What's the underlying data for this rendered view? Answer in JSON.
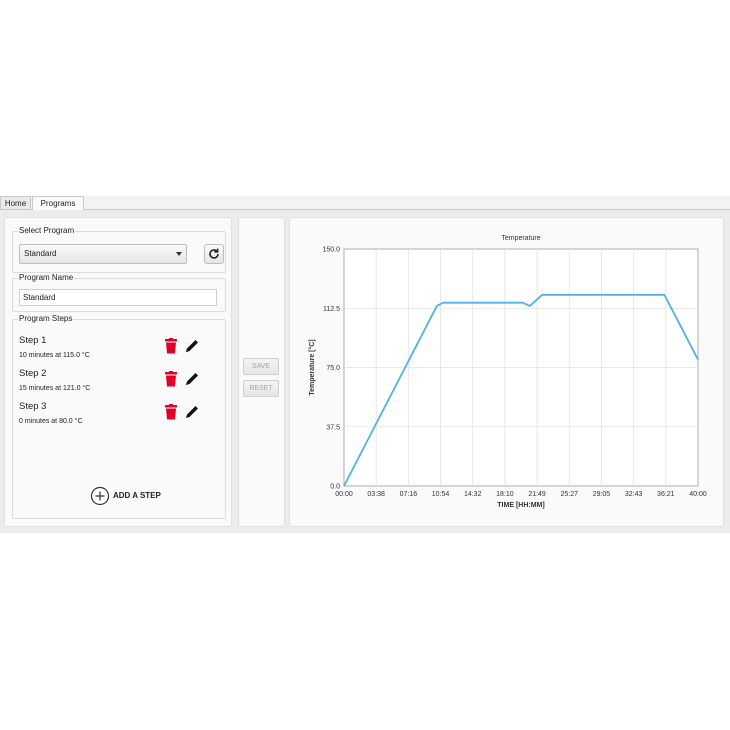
{
  "tabs": [
    {
      "label": "Home"
    },
    {
      "label": "Programs"
    }
  ],
  "select_program": {
    "label": "Select Program",
    "value": "Standard"
  },
  "program_name": {
    "label": "Program Name",
    "value": "Standard"
  },
  "program_steps": {
    "label": "Program Steps",
    "steps": [
      {
        "title": "Step 1",
        "desc": "10 minutes at 115.0 °C"
      },
      {
        "title": "Step 2",
        "desc": "15 minutes at 121.0 °C"
      },
      {
        "title": "Step 3",
        "desc": "0 minutes at 80.0 °C"
      }
    ],
    "add_label": "ADD A STEP"
  },
  "buttons": {
    "save": "SAVE",
    "reset": "RESET"
  },
  "colors": {
    "line": "#4fb3e0",
    "delete": "#e0002a",
    "accent_disabled": "#a5a5a5"
  },
  "chart_data": {
    "type": "line",
    "title": "Temperature",
    "xlabel": "TIME [HH:MM]",
    "ylabel": "Temperature [°C]",
    "x_tick_labels": [
      "00:00",
      "03:38",
      "07:16",
      "10:54",
      "14:32",
      "18:10",
      "21:49",
      "25:27",
      "29:05",
      "32:43",
      "36:21",
      "40:00"
    ],
    "y_tick_labels": [
      "0.0",
      "37.5",
      "75.0",
      "112.5",
      "150.0"
    ],
    "y_ticks": [
      0,
      37.5,
      75,
      112.5,
      150
    ],
    "xlim": [
      0,
      40
    ],
    "ylim": [
      0,
      150
    ],
    "grid": true,
    "series": [
      {
        "x": [
          0,
          10.5,
          11.2,
          20.2,
          21.0,
          22.4,
          35.5,
          36.2,
          40.0
        ],
        "y": [
          0,
          114,
          116,
          116,
          114,
          121,
          121,
          121,
          80
        ]
      }
    ]
  }
}
